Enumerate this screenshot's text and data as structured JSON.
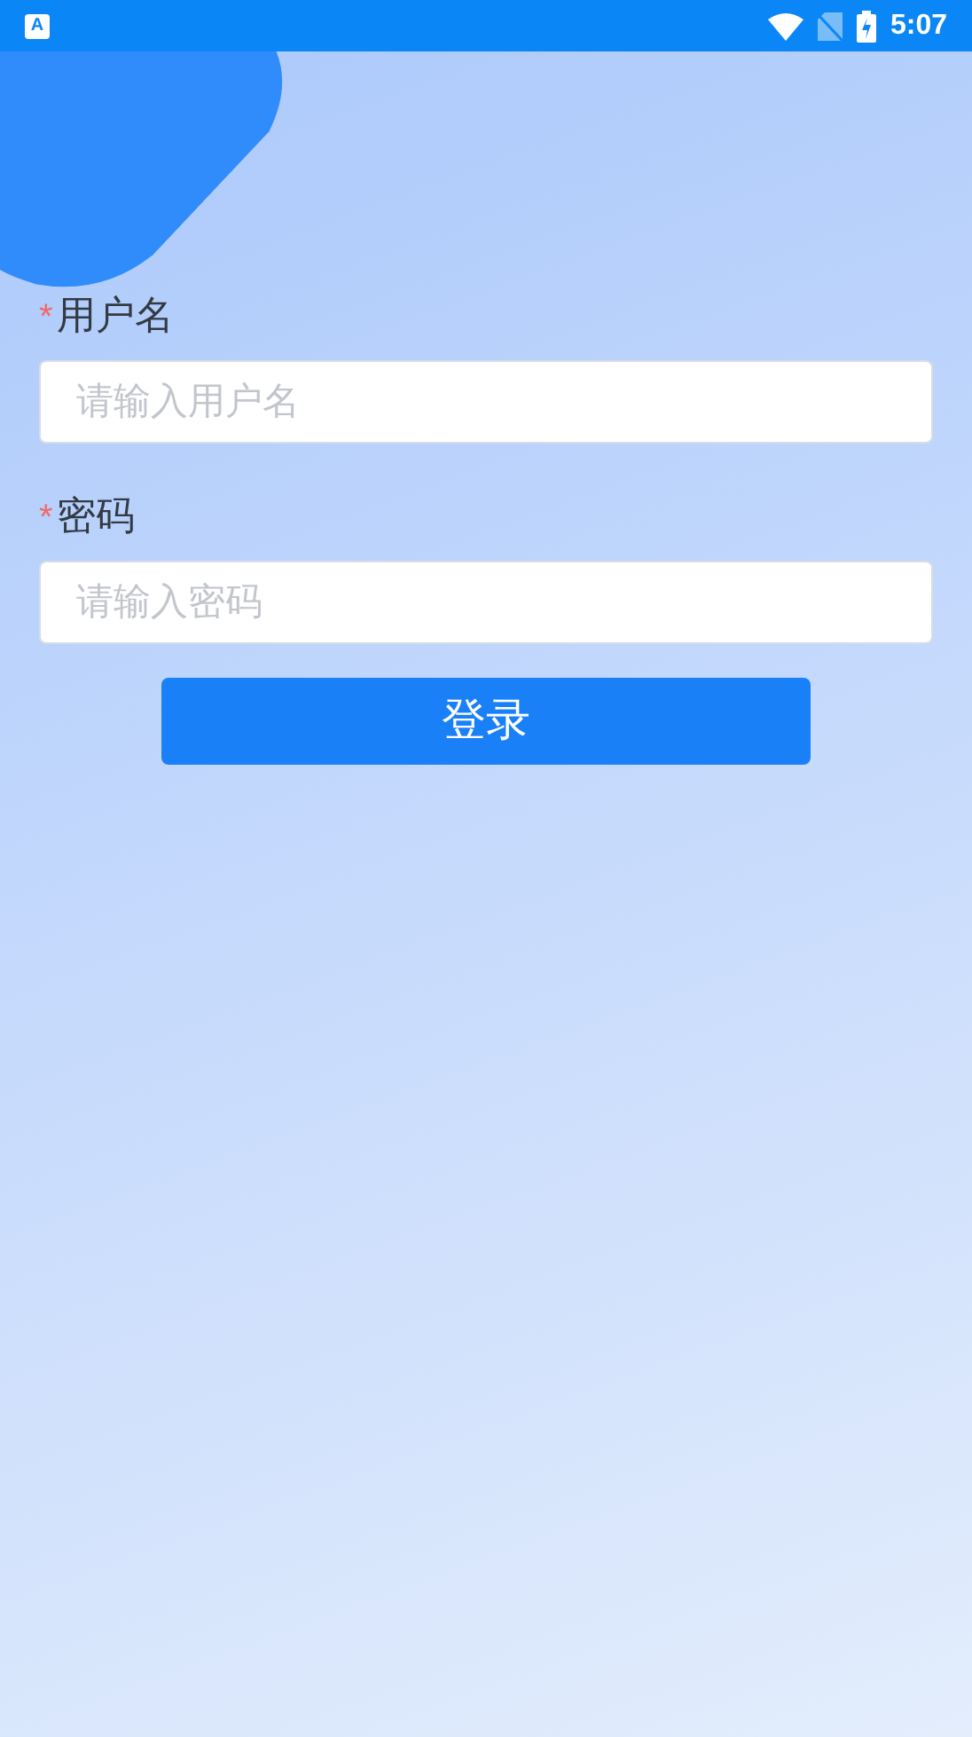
{
  "status_bar": {
    "app_icon": "A",
    "time": "5:07"
  },
  "fields": [
    {
      "required_mark": "*",
      "label": "用户名",
      "placeholder": "请输入用户名"
    },
    {
      "required_mark": "*",
      "label": "密码",
      "placeholder": "请输入密码"
    }
  ],
  "login_button": "登录"
}
